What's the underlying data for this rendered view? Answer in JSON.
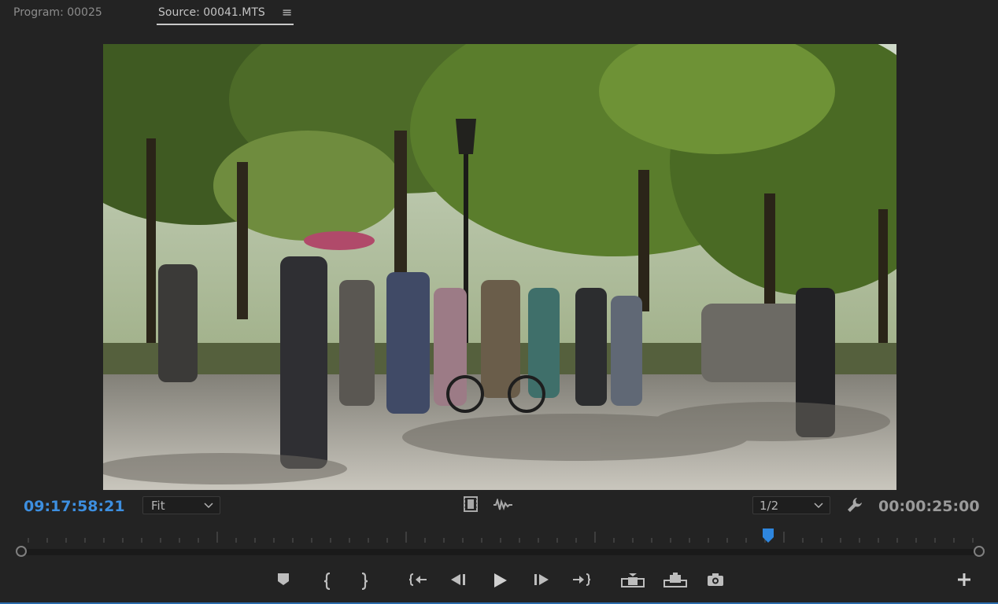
{
  "tabs": {
    "program": "Program: 00025",
    "source": "Source: 00041.MTS"
  },
  "monitor": {
    "current_timecode": "09:17:58:21",
    "zoom": "Fit",
    "resolution": "1/2",
    "duration": "00:00:25:00"
  },
  "playhead_position": 0.78,
  "colors": {
    "background": "#232323",
    "timecode_blue": "#3d8fe0",
    "playhead_blue": "#2e86de"
  },
  "icons": {
    "panel_menu": "hamburger-menu-icon",
    "drag_video": "film-strip-icon",
    "drag_audio": "audio-waveform-icon",
    "settings": "wrench-icon",
    "add_button": "plus-icon"
  },
  "transport_buttons": [
    "add-marker-button",
    "mark-in-button",
    "mark-out-button",
    "go-to-in-button",
    "step-back-button",
    "play-button",
    "step-forward-button",
    "go-to-out-button",
    "insert-button",
    "overwrite-button",
    "export-frame-button"
  ]
}
